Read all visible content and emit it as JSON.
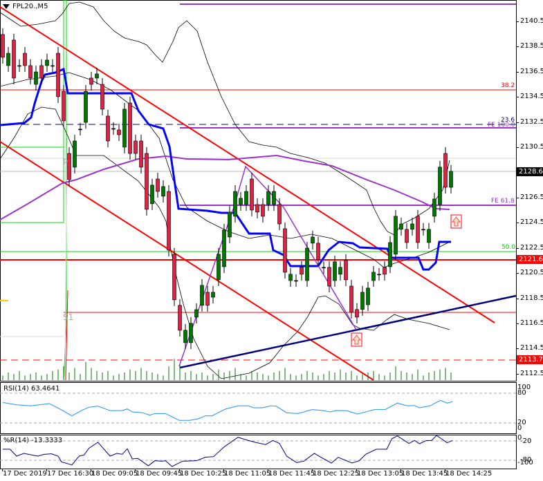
{
  "chart_header": {
    "symbol_label": "FPL20.,M5"
  },
  "price_axis": {
    "ticks": [
      "2140.5",
      "2138.5",
      "2136.5",
      "2134.5",
      "2132.5",
      "2130.5",
      "2126.5",
      "2124.5",
      "2122.5",
      "2120.5",
      "2118.5",
      "2116.5",
      "2114.5",
      "2112.5"
    ],
    "tick_values": [
      2140.5,
      2138.5,
      2136.5,
      2134.5,
      2132.5,
      2130.5,
      2126.5,
      2124.5,
      2122.5,
      2120.5,
      2118.5,
      2116.5,
      2114.5,
      2112.5
    ],
    "current_price": "2128.6",
    "level_badges": [
      "2121.6",
      "2113.7"
    ]
  },
  "levels": {
    "fib_38": "38.2",
    "fib_23": "23.6",
    "fe_100": "FE 100.0",
    "fe_61": "FE 61.8",
    "fib_50": "50.0",
    "pivot_p": "P",
    "pivot_s1": "S1"
  },
  "colors": {
    "bull": "#007700",
    "bear": "#dd2244",
    "ma_blue": "#0000ff",
    "ma_purple": "#9933cc",
    "channel": "#ff0000",
    "trend": "#000080",
    "green_level": "#00dd00"
  },
  "chart_data": [
    {
      "type": "candlestick",
      "title": "FPL20.,M5",
      "ylim": [
        2111.5,
        2141.8
      ],
      "candles_open_close": [
        [
          2139.46,
          2137.65
        ],
        [
          2136.99,
          2137.97
        ],
        [
          2139.02,
          2136.0
        ],
        [
          2136.99,
          2136.99
        ],
        [
          2137.97,
          2136.99
        ],
        [
          2136.99,
          2136.0
        ],
        [
          2135.5,
          2136.49
        ],
        [
          2136.99,
          2136.0
        ],
        [
          2136.99,
          2137.43
        ],
        [
          2136.99,
          2136.99
        ],
        [
          2137.97,
          2134.52
        ],
        [
          2134.95,
          2132.6
        ],
        [
          2130.01,
          2127.93
        ],
        [
          2128.92,
          2131.0
        ],
        [
          2131.94,
          2131.94
        ],
        [
          2132.48,
          2134.95
        ],
        [
          2136.0,
          2135.5
        ],
        [
          2136.0,
          2136.33
        ],
        [
          2135.5,
          2133.53
        ],
        [
          2132.98,
          2131.0
        ],
        [
          2131.99,
          2131.99
        ],
        [
          2131.88,
          2131.5
        ],
        [
          2130.51,
          2133.53
        ],
        [
          2134.02,
          2130.01
        ],
        [
          2131.0,
          2130.01
        ],
        [
          2131.0,
          2128.92
        ],
        [
          2130.01,
          2125.57
        ],
        [
          2126.01,
          2127.49
        ],
        [
          2127.98,
          2126.99
        ],
        [
          2126.61,
          2127.38
        ],
        [
          2126.99,
          2122.33
        ],
        [
          2122.0,
          2118.38
        ],
        [
          2117.94,
          2115.96
        ],
        [
          2114.97,
          2115.96
        ],
        [
          2114.97,
          2116.51
        ],
        [
          2117.0,
          2117.6
        ],
        [
          2117.94,
          2119.53
        ],
        [
          2118.98,
          2117.94
        ],
        [
          2118.59,
          2118.98
        ],
        [
          2119.97,
          2122.0
        ],
        [
          2121.01,
          2123.92
        ],
        [
          2123.37,
          2125.35
        ],
        [
          2125.02,
          2126.99
        ],
        [
          2125.95,
          2126.45
        ],
        [
          2125.95,
          2126.99
        ],
        [
          2127.98,
          2125.51
        ],
        [
          2125.95,
          2125.35
        ],
        [
          2125.95,
          2125.02
        ],
        [
          2125.95,
          2126.99
        ],
        [
          2125.95,
          2126.99
        ],
        [
          2125.95,
          2124.41
        ],
        [
          2124.03,
          2120.57
        ],
        [
          2119.91,
          2120.41
        ],
        [
          2119.91,
          2119.91
        ],
        [
          2120.96,
          2120.41
        ],
        [
          2119.91,
          2122.49
        ],
        [
          2122.88,
          2123.37
        ],
        [
          2122.88,
          2121.56
        ],
        [
          2120.96,
          2120.96
        ],
        [
          2120.96,
          2119.47
        ],
        [
          2119.91,
          2121.4
        ],
        [
          2120.41,
          2120.96
        ],
        [
          2121.51,
          2119.97
        ],
        [
          2119.47,
          2117.39
        ],
        [
          2117.61,
          2117.0
        ],
        [
          2117.61,
          2118.98
        ],
        [
          2117.99,
          2119.31
        ],
        [
          2119.91,
          2120.57
        ],
        [
          2120.41,
          2120.41
        ],
        [
          2120.96,
          2120.41
        ],
        [
          2121.01,
          2122.93
        ],
        [
          2122.0,
          2125.02
        ],
        [
          2123.98,
          2124.41
        ],
        [
          2123.98,
          2122.93
        ],
        [
          2123.98,
          2124.41
        ],
        [
          2125.02,
          2122.93
        ],
        [
          2123.98,
          2123.98
        ],
        [
          2122.93,
          2123.98
        ],
        [
          2125.02,
          2126.39
        ],
        [
          2125.95,
          2128.92
        ],
        [
          2130.01,
          2127.32
        ],
        [
          2127.32,
          2128.59
        ]
      ],
      "volume": [
        3,
        5,
        4,
        6,
        3,
        4,
        5,
        3,
        4,
        6,
        7,
        9,
        5,
        8,
        4,
        12,
        8,
        6,
        5,
        6,
        3,
        4,
        5,
        7,
        6,
        8,
        6,
        5,
        4,
        3,
        9,
        14,
        10,
        5,
        6,
        4,
        5,
        3,
        4,
        7,
        5,
        6,
        8,
        4,
        3,
        6,
        5,
        4,
        3,
        5,
        6,
        8,
        4,
        3,
        4,
        6,
        5,
        3,
        4,
        6,
        5,
        7,
        5,
        6,
        3,
        4,
        5,
        6,
        4,
        3,
        5,
        9,
        6,
        5,
        4,
        7,
        3,
        5,
        6,
        7,
        8,
        5
      ],
      "xlabels": [
        "17 Dec 2019",
        "17 Dec 16:30",
        "18 Dec 09:05",
        "18 Dec 09:45",
        "18 Dec 10:25",
        "18 Dec 11:05",
        "18 Dec 11:45",
        "18 Dec 12:25",
        "18 Dec 13:05",
        "18 Dec 13:45",
        "18 Dec 14:25"
      ]
    },
    {
      "type": "line",
      "title": "RSI(14) 63.4641",
      "ylim": [
        0,
        100
      ],
      "yticks": [
        "100",
        "80",
        "20",
        "0"
      ],
      "levels": [
        80,
        20
      ],
      "points": [
        [
          0,
          61.4
        ],
        [
          2.5,
          56.7
        ],
        [
          5,
          54.5
        ],
        [
          8.4,
          59.1
        ],
        [
          10.3,
          48.3
        ],
        [
          12.5,
          34.4
        ],
        [
          14.4,
          46.1
        ],
        [
          15.6,
          51.7
        ],
        [
          17.2,
          54
        ],
        [
          19.4,
          44.7
        ],
        [
          21.6,
          45.1
        ],
        [
          22.5,
          48.3
        ],
        [
          23.4,
          42.3
        ],
        [
          25.3,
          40.5
        ],
        [
          26.6,
          35.8
        ],
        [
          27.5,
          39.1
        ],
        [
          29.4,
          39.1
        ],
        [
          31.9,
          25.2
        ],
        [
          33.8,
          25.2
        ],
        [
          35.3,
          28.4
        ],
        [
          36.6,
          34.4
        ],
        [
          37.8,
          34.4
        ],
        [
          40.3,
          48.3
        ],
        [
          42.5,
          54.5
        ],
        [
          44.4,
          54.5
        ],
        [
          45.3,
          50.7
        ],
        [
          46.9,
          50.7
        ],
        [
          48.4,
          54.5
        ],
        [
          49.4,
          54
        ],
        [
          51.3,
          40.5
        ],
        [
          53.4,
          39.1
        ],
        [
          55.9,
          47
        ],
        [
          57.8,
          45.1
        ],
        [
          59.1,
          42.3
        ],
        [
          60.3,
          45.1
        ],
        [
          62.2,
          44.7
        ],
        [
          64.1,
          38.2
        ],
        [
          65.3,
          41.4
        ],
        [
          67.2,
          47
        ],
        [
          69.1,
          47
        ],
        [
          71.3,
          60
        ],
        [
          73.1,
          54.5
        ],
        [
          74.4,
          55.3
        ],
        [
          75.3,
          50.7
        ],
        [
          77.2,
          54.5
        ],
        [
          79.1,
          65.6
        ],
        [
          80.3,
          60
        ],
        [
          81.3,
          63.3
        ]
      ]
    },
    {
      "type": "line",
      "title": "%R(14) -13.3333",
      "ylim": [
        -100,
        0
      ],
      "yticks": [
        "0",
        "-20",
        "-80",
        "-100"
      ],
      "levels": [
        -20,
        -80
      ],
      "points": [
        [
          0,
          -45.7
        ],
        [
          1.3,
          -45.7
        ],
        [
          2.5,
          -67.1
        ],
        [
          3.8,
          -58.5
        ],
        [
          6.3,
          -67.1
        ],
        [
          7.5,
          -61.4
        ],
        [
          8.8,
          -60
        ],
        [
          10,
          -67.1
        ],
        [
          10.6,
          -84.9
        ],
        [
          12.5,
          -94.3
        ],
        [
          13.8,
          -67.1
        ],
        [
          14.7,
          -63.5
        ],
        [
          15.6,
          -42.1
        ],
        [
          17.2,
          -24.3
        ],
        [
          19.4,
          -67.1
        ],
        [
          20.6,
          -58.5
        ],
        [
          21.6,
          -61.4
        ],
        [
          22.5,
          -44.3
        ],
        [
          23.4,
          -75.7
        ],
        [
          24.4,
          -74.2
        ],
        [
          26.3,
          -97
        ],
        [
          27.5,
          -81.4
        ],
        [
          28.8,
          -82.8
        ],
        [
          29.4,
          -81.4
        ],
        [
          30.6,
          -99.2
        ],
        [
          32.5,
          -82.8
        ],
        [
          35,
          -81.4
        ],
        [
          36.6,
          -70.7
        ],
        [
          38.1,
          -68.6
        ],
        [
          40,
          -38.6
        ],
        [
          42.5,
          -8.7
        ],
        [
          43.8,
          -15.7
        ],
        [
          45.6,
          -24.3
        ],
        [
          47.5,
          -31.4
        ],
        [
          48.8,
          -18.6
        ],
        [
          50,
          -27.9
        ],
        [
          51.3,
          -67.1
        ],
        [
          53.1,
          -87
        ],
        [
          54.4,
          -82.8
        ],
        [
          56.3,
          -58.5
        ],
        [
          57.5,
          -70.7
        ],
        [
          59.4,
          -88.5
        ],
        [
          60.6,
          -70.7
        ],
        [
          63.1,
          -88.5
        ],
        [
          64.4,
          -81.4
        ],
        [
          65.6,
          -61.4
        ],
        [
          67.5,
          -45.7
        ],
        [
          69.4,
          -45.7
        ],
        [
          70.3,
          -13.6
        ],
        [
          71.3,
          -4.4
        ],
        [
          73.4,
          -27.9
        ],
        [
          74.4,
          -18.6
        ],
        [
          75.3,
          -28.6
        ],
        [
          76.6,
          -18.6
        ],
        [
          77.5,
          -18.6
        ],
        [
          78.4,
          -2.9
        ],
        [
          80.3,
          -25.7
        ],
        [
          81.3,
          -18.6
        ]
      ]
    }
  ]
}
